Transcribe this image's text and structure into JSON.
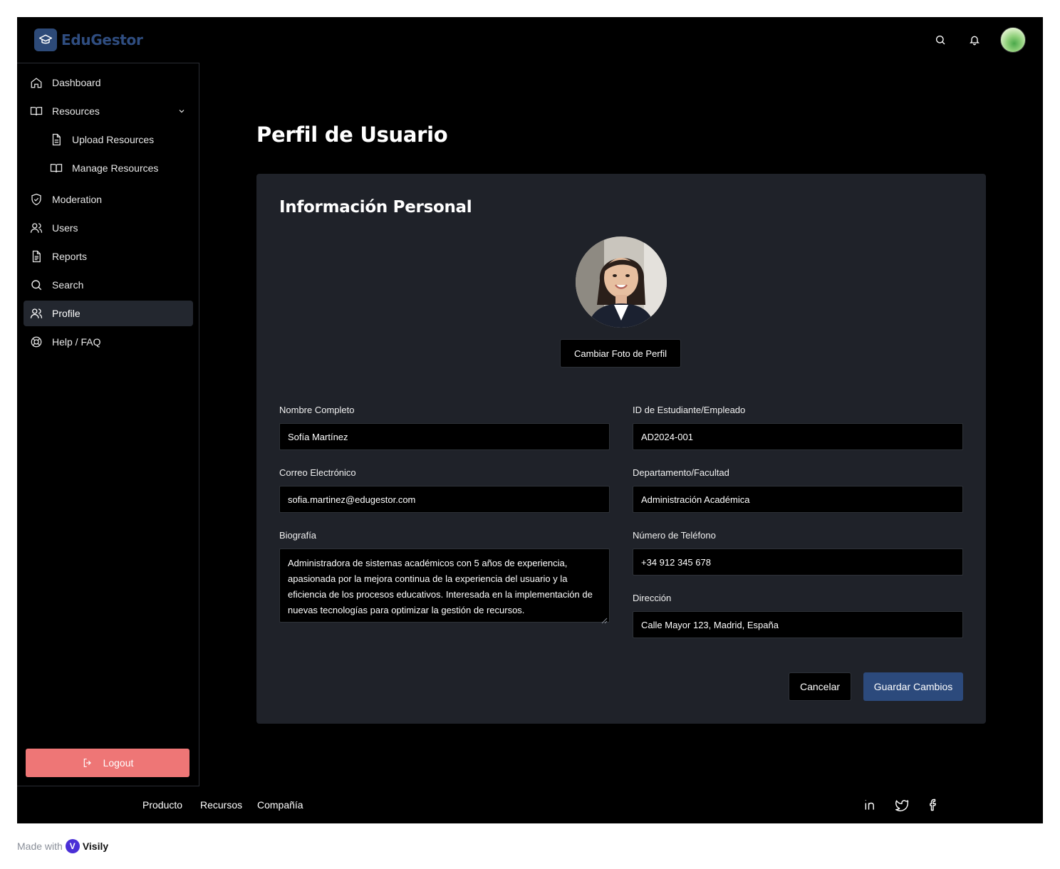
{
  "app": {
    "name": "EduGestor"
  },
  "header": {
    "search_icon": "search-icon",
    "bell_icon": "bell-icon"
  },
  "sidebar": {
    "items": [
      {
        "label": "Dashboard",
        "icon": "home-icon"
      },
      {
        "label": "Resources",
        "icon": "book-icon",
        "expanded": true
      },
      {
        "label": "Upload Resources",
        "icon": "file-icon"
      },
      {
        "label": "Manage Resources",
        "icon": "book-icon"
      },
      {
        "label": "Moderation",
        "icon": "shield-check-icon"
      },
      {
        "label": "Users",
        "icon": "users-icon"
      },
      {
        "label": "Reports",
        "icon": "file-text-icon"
      },
      {
        "label": "Search",
        "icon": "search-icon"
      },
      {
        "label": "Profile",
        "icon": "users-icon",
        "active": true
      },
      {
        "label": "Help / FAQ",
        "icon": "lifebuoy-icon"
      }
    ],
    "logout_label": "Logout"
  },
  "main": {
    "page_title": "Perfil de Usuario",
    "card_title": "Información Personal",
    "change_photo_label": "Cambiar Foto de Perfil",
    "fields": {
      "full_name": {
        "label": "Nombre Completo",
        "value": "Sofía Martínez"
      },
      "id": {
        "label": "ID de Estudiante/Empleado",
        "value": "AD2024-001"
      },
      "email": {
        "label": "Correo Electrónico",
        "value": "sofia.martinez@edugestor.com"
      },
      "department": {
        "label": "Departamento/Facultad",
        "value": "Administración Académica"
      },
      "bio": {
        "label": "Biografía",
        "value": "Administradora de sistemas académicos con 5 años de experiencia, apasionada por la mejora continua de la experiencia del usuario y la eficiencia de los procesos educativos. Interesada en la implementación de nuevas tecnologías para optimizar la gestión de recursos."
      },
      "phone": {
        "label": "Número de Teléfono",
        "value": "+34 912 345 678"
      },
      "address": {
        "label": "Dirección",
        "value": "Calle Mayor 123, Madrid, España"
      }
    },
    "cancel_label": "Cancelar",
    "save_label": "Guardar Cambios"
  },
  "footer": {
    "links": [
      "Producto",
      "Recursos",
      "Compañía"
    ],
    "social_icons": [
      "linkedin-icon",
      "twitter-icon",
      "facebook-icon"
    ]
  },
  "made_with": {
    "prefix": "Made with",
    "brand": "Visily"
  },
  "colors": {
    "background": "#000000",
    "card": "#1f2229",
    "primary": "#2c4a7c",
    "logout": "#ee7676",
    "logo": "#2f4d80"
  }
}
